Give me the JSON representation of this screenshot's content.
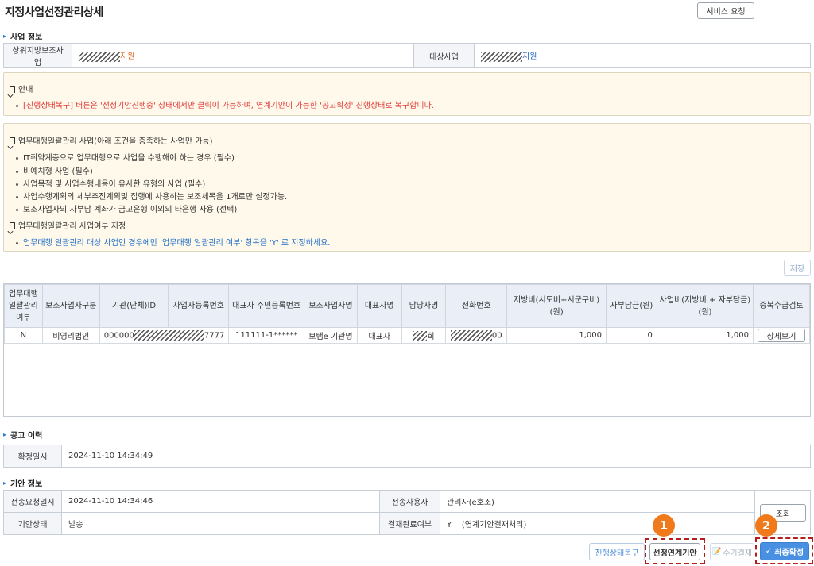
{
  "page_title": "지정사업선정관리상세",
  "service_request": "서비스 요청",
  "business_info": {
    "title": "사업 정보",
    "parent_label": "상위지방보조사업",
    "parent_value_suffix": "지원",
    "target_label": "대상사업",
    "target_value_suffix": "지원"
  },
  "notice1": {
    "title": "안내",
    "line": "[진행상태복구] 버튼은 '선정기안진행중' 상태에서만 클릭이 가능하며, 연계기안이 가능한 '공고확정' 진행상태로 복구합니다."
  },
  "notice2": {
    "title": "업무대행일괄관리 사업(아래 조건을 충족하는 사업만 가능)",
    "items": [
      "IT취약계층으로 업무대행으로 사업을 수행해야 하는 경우 (필수)",
      "비예치형 사업 (필수)",
      "사업목적 및 사업수행내용이 유사한 유형의 사업 (필수)",
      "사업수행계획의 세부추진계획및 집행에 사용하는 보조세목을 1개로만 설정가능.",
      "보조사업자의 자부담 계좌가 금고은행 이외의 타은행 사용 (선택)"
    ],
    "title2": "업무대행일괄관리 사업여부 지정",
    "line2": "업무대행 일괄관리 대상 사업인 경우에만 '업무대행 일괄관리 여부' 항목을 'Y' 로 지정하세요."
  },
  "save_button": "저장",
  "table": {
    "headers": [
      "업무대행\n일괄관리\n여부",
      "보조사업자구분",
      "기관(단체)ID",
      "사업자등록번호",
      "대표자 주민등록번호",
      "보조사업자명",
      "대표자명",
      "담당자명",
      "전화번호",
      "지방비(시도비+시군구비)(원)",
      "자부담금(원)",
      "사업비(지방비 + 자부담금)(원)",
      "중복수급검토"
    ],
    "row": {
      "agency": "비영리법인",
      "id_prefix": "000000",
      "brn_suffix": "7777",
      "rrn": "111111-1******",
      "name": "보탬e 기관명",
      "rep": "대표자",
      "manager_suffix": "희",
      "phone_suffix": "00",
      "local": "1,000",
      "self": "0",
      "total": "1,000",
      "detail_button": "상세보기"
    },
    "select_value": "N"
  },
  "notice_history": {
    "title": "공고 이력",
    "label": "확정일시",
    "value": "2024-11-10 14:34:49"
  },
  "draft_info": {
    "title": "기안 정보",
    "send_date_label": "전송요청일시",
    "send_date_value": "2024-11-10 14:34:46",
    "sender_label": "전송사용자",
    "sender_value": "관리자(e호조)",
    "status_label": "기안상태",
    "status_value": "발송",
    "approval_label": "결재완료여부",
    "approval_value": "Y    (연계기안결재처리)",
    "lookup_button": "조회"
  },
  "bottom": {
    "restore": "진행상태복구",
    "link_draft": "선정연계기안",
    "manual_approval": "수기결재",
    "final_confirm": "최종확정"
  },
  "badges": [
    "1",
    "2"
  ],
  "colors": {
    "badge": "#f07a1b",
    "primary": "#4a90e2",
    "dash": "#b71c1c"
  }
}
